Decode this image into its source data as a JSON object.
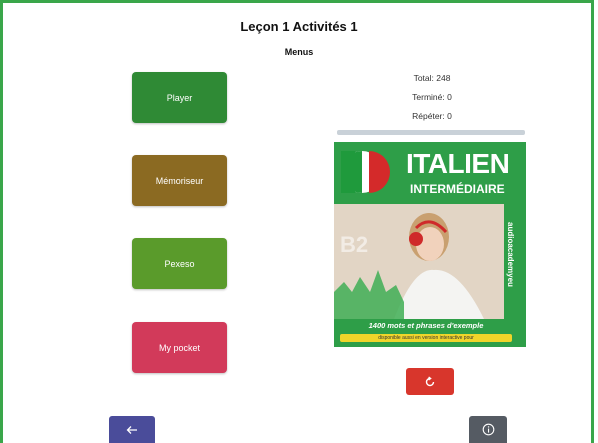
{
  "header": {
    "title": "Leçon 1 Activités 1",
    "subtitle": "Menus"
  },
  "menu": [
    {
      "label": "Player",
      "color": "#2f8a35"
    },
    {
      "label": "Mémoriseur",
      "color": "#8b6a22"
    },
    {
      "label": "Pexeso",
      "color": "#5a9b2b"
    },
    {
      "label": "My pocket",
      "color": "#d23a5a"
    }
  ],
  "stats": {
    "total": "Total: 248",
    "done": "Terminé: 0",
    "repeat": "Répéter: 0",
    "progress_fraction": 0
  },
  "cover": {
    "title": "ITALIEN",
    "level": "INTERMÉDIAIRE",
    "badge": "B2",
    "brand": "audioacademyeu",
    "tagline": "1400 mots et phrases d'exemple",
    "banner": "disponible aussi en version interactive pour"
  },
  "icons": {
    "reset": "refresh-icon",
    "back": "arrow-left-icon",
    "info": "info-icon"
  },
  "colors": {
    "frame": "#3aa64a",
    "reset": "#d8362c",
    "back": "#4a4c9a",
    "info": "#555b63"
  }
}
